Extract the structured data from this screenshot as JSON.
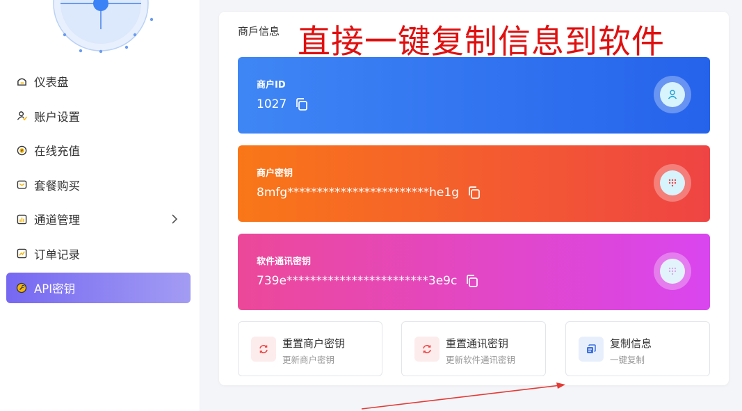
{
  "sidebar": {
    "items": [
      {
        "label": "仪表盘",
        "icon": "dashboard-icon"
      },
      {
        "label": "账户设置",
        "icon": "user-settings-icon"
      },
      {
        "label": "在线充值",
        "icon": "recharge-icon"
      },
      {
        "label": "套餐购买",
        "icon": "package-icon"
      },
      {
        "label": "通道管理",
        "icon": "channel-icon",
        "has_submenu": true
      },
      {
        "label": "订单记录",
        "icon": "order-icon"
      },
      {
        "label": "API密钥",
        "icon": "api-key-icon",
        "active": true
      }
    ]
  },
  "card": {
    "title": "商戶信息",
    "annotation": "直接一键复制信息到软件",
    "merchant_id": {
      "label": "商户ID",
      "value": "1027",
      "icon": "user-icon"
    },
    "merchant_key": {
      "label": "商户密钥",
      "value": "8mfg************************he1g",
      "icon": "keypad-icon"
    },
    "comm_key": {
      "label": "软件通讯密钥",
      "value": "739e************************3e9c",
      "icon": "keypad-icon"
    },
    "actions": [
      {
        "title": "重置商户密钥",
        "subtitle": "更新商户密钥",
        "icon": "refresh-icon"
      },
      {
        "title": "重置通讯密钥",
        "subtitle": "更新软件通讯密钥",
        "icon": "refresh-icon"
      },
      {
        "title": "复制信息",
        "subtitle": "一键复制",
        "icon": "copy-icon"
      }
    ]
  },
  "colors": {
    "active_menu": "#7668f2",
    "id_block": "#3b82f6",
    "key_block": "#f97316",
    "comm_block": "#ec4899",
    "annotation": "#e01010"
  }
}
